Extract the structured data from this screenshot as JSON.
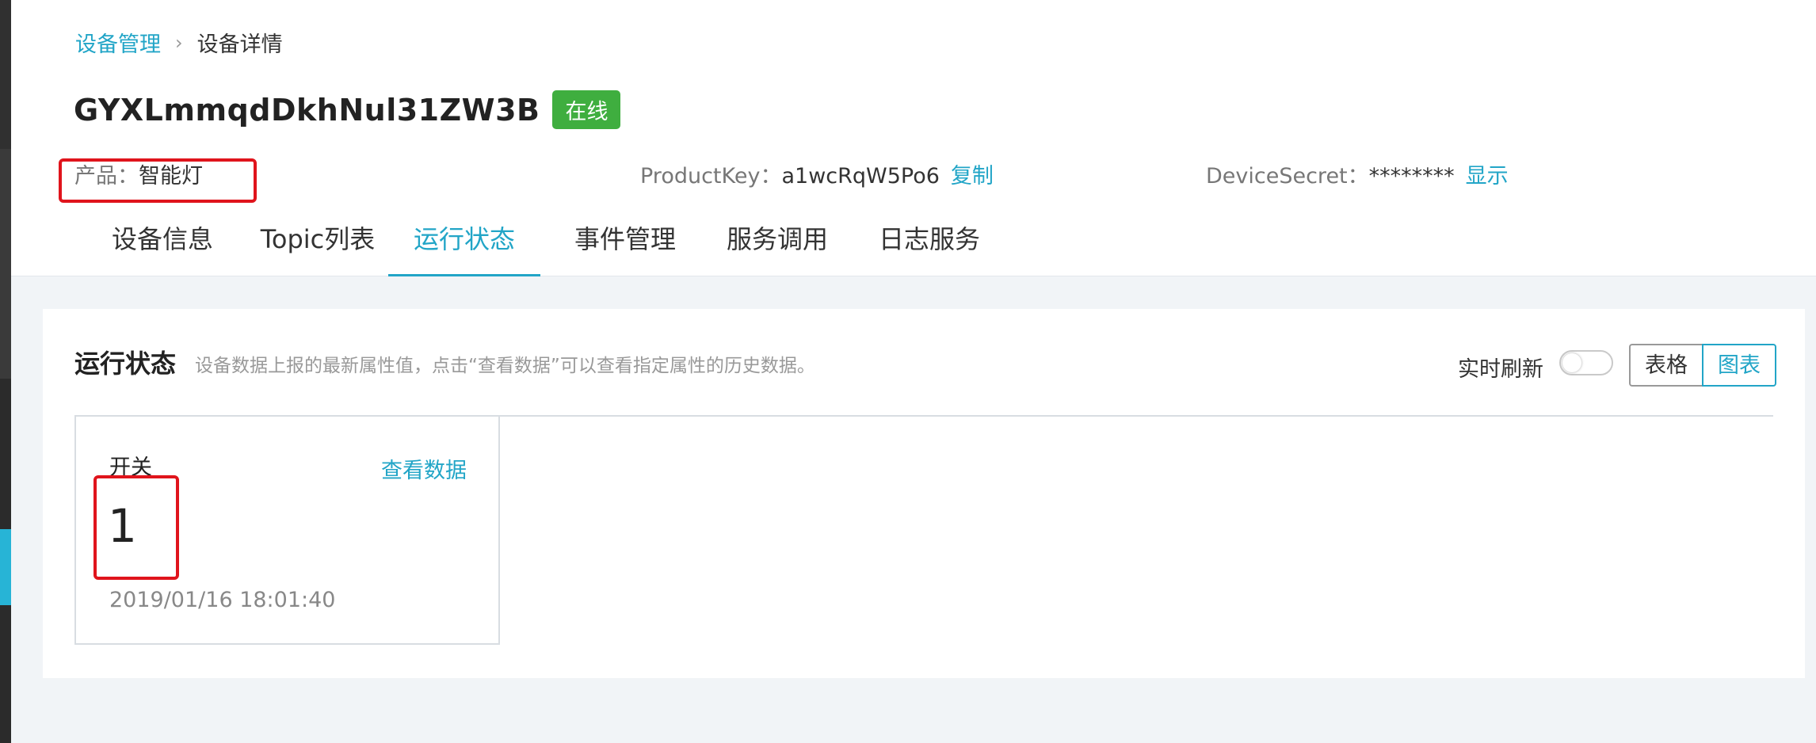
{
  "breadcrumb": {
    "parent": "设备管理",
    "separator": "›",
    "current": "设备详情"
  },
  "device": {
    "name": "GYXLmmqdDkhNul31ZW3B",
    "status": "在线"
  },
  "meta": {
    "product_label": "产品：",
    "product_value": "智能灯",
    "productkey_label": "ProductKey：",
    "productkey_value": "a1wcRqW5Po6",
    "productkey_action": "复制",
    "secret_label": "DeviceSecret：",
    "secret_value": "********",
    "secret_action": "显示"
  },
  "tabs": [
    {
      "label": "设备信息"
    },
    {
      "label": "Topic列表"
    },
    {
      "label": "运行状态",
      "active": true
    },
    {
      "label": "事件管理"
    },
    {
      "label": "服务调用"
    },
    {
      "label": "日志服务"
    }
  ],
  "panel": {
    "title": "运行状态",
    "description": "设备数据上报的最新属性值，点击“查看数据”可以查看指定属性的历史数据。",
    "refresh_label": "实时刷新",
    "refresh_on": false,
    "view_table": "表格",
    "view_chart": "图表"
  },
  "properties": [
    {
      "name": "开关",
      "action": "查看数据",
      "value": "1",
      "timestamp": "2019/01/16 18:01:40"
    }
  ],
  "colors": {
    "accent": "#22a5c7",
    "online": "#3fae3f",
    "highlight": "#e0141c"
  }
}
